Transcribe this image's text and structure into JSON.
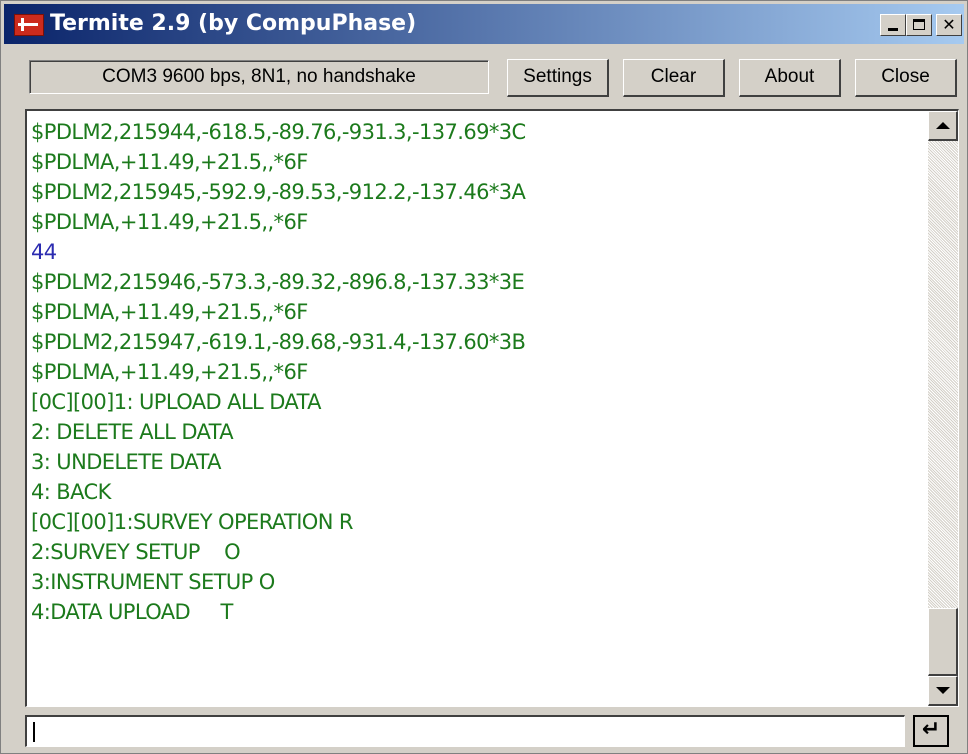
{
  "window": {
    "title": "Termite 2.9 (by CompuPhase)",
    "icon": "termite-app-icon"
  },
  "toolbar": {
    "status": "COM3 9600 bps, 8N1, no handshake",
    "settings_label": "Settings",
    "clear_label": "Clear",
    "about_label": "About",
    "close_label": "Close"
  },
  "output": {
    "lines": [
      {
        "text": "$PDLM2,215944,-618.5,-89.76,-931.3,-137.69*3C",
        "color": "#1c7a1c"
      },
      {
        "text": "$PDLMA,+11.49,+21.5,,*6F",
        "color": "#1c7a1c"
      },
      {
        "text": "$PDLM2,215945,-592.9,-89.53,-912.2,-137.46*3A",
        "color": "#1c7a1c"
      },
      {
        "text": "$PDLMA,+11.49,+21.5,,*6F",
        "color": "#1c7a1c"
      },
      {
        "text": "44",
        "color": "#2b2bb0"
      },
      {
        "text": "$PDLM2,215946,-573.3,-89.32,-896.8,-137.33*3E",
        "color": "#1c7a1c"
      },
      {
        "text": "$PDLMA,+11.49,+21.5,,*6F",
        "color": "#1c7a1c"
      },
      {
        "text": "$PDLM2,215947,-619.1,-89.68,-931.4,-137.60*3B",
        "color": "#1c7a1c"
      },
      {
        "text": "$PDLMA,+11.49,+21.5,,*6F",
        "color": "#1c7a1c"
      },
      {
        "text": "[0C][00]1: UPLOAD ALL DATA",
        "color": "#1c7a1c"
      },
      {
        "text": "2: DELETE ALL DATA",
        "color": "#1c7a1c"
      },
      {
        "text": "3: UNDELETE DATA",
        "color": "#1c7a1c"
      },
      {
        "text": "4: BACK",
        "color": "#1c7a1c"
      },
      {
        "text": "[0C][00]1:SURVEY OPERATION R",
        "color": "#1c7a1c"
      },
      {
        "text": "2:SURVEY SETUP    O",
        "color": "#1c7a1c"
      },
      {
        "text": "3:INSTRUMENT SETUP O",
        "color": "#1c7a1c"
      },
      {
        "text": "4:DATA UPLOAD     T",
        "color": "#1c7a1c"
      }
    ]
  },
  "input": {
    "value": ""
  },
  "send_icon": "enter-arrow-icon"
}
